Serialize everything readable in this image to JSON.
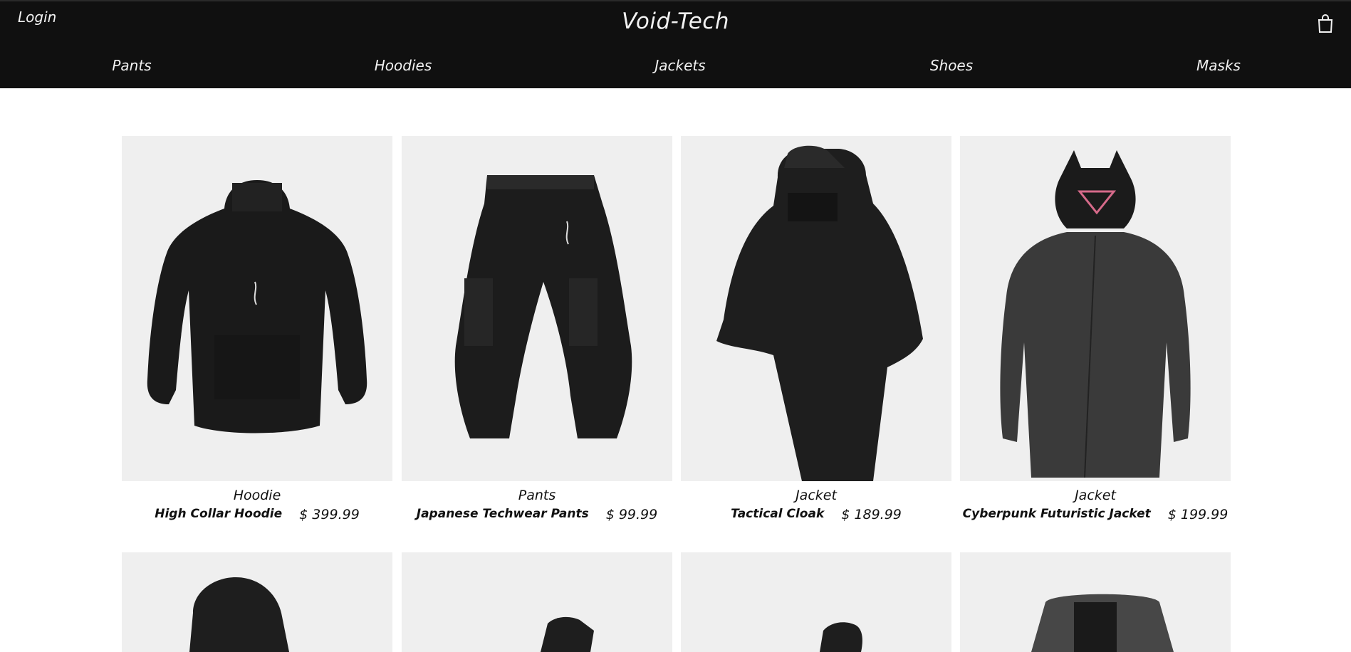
{
  "header": {
    "login_label": "Login",
    "brand": "Void-Tech",
    "cart_icon": "shopping-bag-icon"
  },
  "nav": {
    "items": [
      {
        "label": "Pants"
      },
      {
        "label": "Hoodies"
      },
      {
        "label": "Jackets"
      },
      {
        "label": "Shoes"
      },
      {
        "label": "Masks"
      }
    ]
  },
  "products": [
    {
      "category": "Hoodie",
      "name": "High Collar Hoodie",
      "price": "$ 399.99"
    },
    {
      "category": "Pants",
      "name": "Japanese Techwear Pants",
      "price": "$ 99.99"
    },
    {
      "category": "Jacket",
      "name": "Tactical Cloak",
      "price": "$ 189.99"
    },
    {
      "category": "Jacket",
      "name": "Cyberpunk Futuristic Jacket",
      "price": "$ 199.99"
    }
  ],
  "colors": {
    "header_bg": "#101010",
    "header_text": "#f2f2f2",
    "card_bg": "#efefef",
    "page_bg": "#ffffff"
  }
}
